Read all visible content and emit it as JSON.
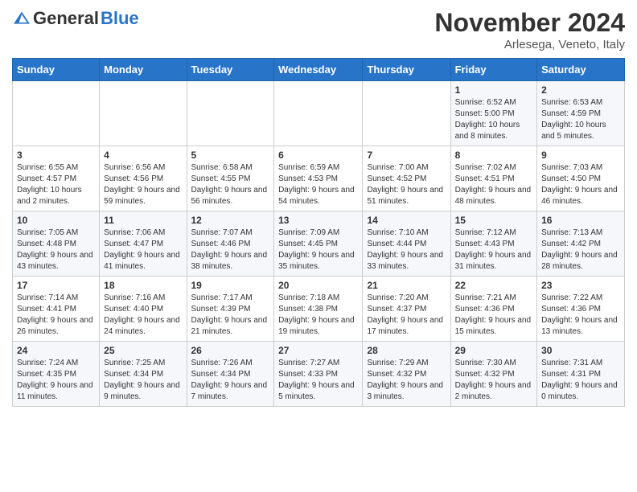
{
  "logo": {
    "general": "General",
    "blue": "Blue"
  },
  "title": "November 2024",
  "location": "Arlesega, Veneto, Italy",
  "days_of_week": [
    "Sunday",
    "Monday",
    "Tuesday",
    "Wednesday",
    "Thursday",
    "Friday",
    "Saturday"
  ],
  "weeks": [
    [
      {
        "day": "",
        "info": ""
      },
      {
        "day": "",
        "info": ""
      },
      {
        "day": "",
        "info": ""
      },
      {
        "day": "",
        "info": ""
      },
      {
        "day": "",
        "info": ""
      },
      {
        "day": "1",
        "info": "Sunrise: 6:52 AM\nSunset: 5:00 PM\nDaylight: 10 hours and 8 minutes."
      },
      {
        "day": "2",
        "info": "Sunrise: 6:53 AM\nSunset: 4:59 PM\nDaylight: 10 hours and 5 minutes."
      }
    ],
    [
      {
        "day": "3",
        "info": "Sunrise: 6:55 AM\nSunset: 4:57 PM\nDaylight: 10 hours and 2 minutes."
      },
      {
        "day": "4",
        "info": "Sunrise: 6:56 AM\nSunset: 4:56 PM\nDaylight: 9 hours and 59 minutes."
      },
      {
        "day": "5",
        "info": "Sunrise: 6:58 AM\nSunset: 4:55 PM\nDaylight: 9 hours and 56 minutes."
      },
      {
        "day": "6",
        "info": "Sunrise: 6:59 AM\nSunset: 4:53 PM\nDaylight: 9 hours and 54 minutes."
      },
      {
        "day": "7",
        "info": "Sunrise: 7:00 AM\nSunset: 4:52 PM\nDaylight: 9 hours and 51 minutes."
      },
      {
        "day": "8",
        "info": "Sunrise: 7:02 AM\nSunset: 4:51 PM\nDaylight: 9 hours and 48 minutes."
      },
      {
        "day": "9",
        "info": "Sunrise: 7:03 AM\nSunset: 4:50 PM\nDaylight: 9 hours and 46 minutes."
      }
    ],
    [
      {
        "day": "10",
        "info": "Sunrise: 7:05 AM\nSunset: 4:48 PM\nDaylight: 9 hours and 43 minutes."
      },
      {
        "day": "11",
        "info": "Sunrise: 7:06 AM\nSunset: 4:47 PM\nDaylight: 9 hours and 41 minutes."
      },
      {
        "day": "12",
        "info": "Sunrise: 7:07 AM\nSunset: 4:46 PM\nDaylight: 9 hours and 38 minutes."
      },
      {
        "day": "13",
        "info": "Sunrise: 7:09 AM\nSunset: 4:45 PM\nDaylight: 9 hours and 35 minutes."
      },
      {
        "day": "14",
        "info": "Sunrise: 7:10 AM\nSunset: 4:44 PM\nDaylight: 9 hours and 33 minutes."
      },
      {
        "day": "15",
        "info": "Sunrise: 7:12 AM\nSunset: 4:43 PM\nDaylight: 9 hours and 31 minutes."
      },
      {
        "day": "16",
        "info": "Sunrise: 7:13 AM\nSunset: 4:42 PM\nDaylight: 9 hours and 28 minutes."
      }
    ],
    [
      {
        "day": "17",
        "info": "Sunrise: 7:14 AM\nSunset: 4:41 PM\nDaylight: 9 hours and 26 minutes."
      },
      {
        "day": "18",
        "info": "Sunrise: 7:16 AM\nSunset: 4:40 PM\nDaylight: 9 hours and 24 minutes."
      },
      {
        "day": "19",
        "info": "Sunrise: 7:17 AM\nSunset: 4:39 PM\nDaylight: 9 hours and 21 minutes."
      },
      {
        "day": "20",
        "info": "Sunrise: 7:18 AM\nSunset: 4:38 PM\nDaylight: 9 hours and 19 minutes."
      },
      {
        "day": "21",
        "info": "Sunrise: 7:20 AM\nSunset: 4:37 PM\nDaylight: 9 hours and 17 minutes."
      },
      {
        "day": "22",
        "info": "Sunrise: 7:21 AM\nSunset: 4:36 PM\nDaylight: 9 hours and 15 minutes."
      },
      {
        "day": "23",
        "info": "Sunrise: 7:22 AM\nSunset: 4:36 PM\nDaylight: 9 hours and 13 minutes."
      }
    ],
    [
      {
        "day": "24",
        "info": "Sunrise: 7:24 AM\nSunset: 4:35 PM\nDaylight: 9 hours and 11 minutes."
      },
      {
        "day": "25",
        "info": "Sunrise: 7:25 AM\nSunset: 4:34 PM\nDaylight: 9 hours and 9 minutes."
      },
      {
        "day": "26",
        "info": "Sunrise: 7:26 AM\nSunset: 4:34 PM\nDaylight: 9 hours and 7 minutes."
      },
      {
        "day": "27",
        "info": "Sunrise: 7:27 AM\nSunset: 4:33 PM\nDaylight: 9 hours and 5 minutes."
      },
      {
        "day": "28",
        "info": "Sunrise: 7:29 AM\nSunset: 4:32 PM\nDaylight: 9 hours and 3 minutes."
      },
      {
        "day": "29",
        "info": "Sunrise: 7:30 AM\nSunset: 4:32 PM\nDaylight: 9 hours and 2 minutes."
      },
      {
        "day": "30",
        "info": "Sunrise: 7:31 AM\nSunset: 4:31 PM\nDaylight: 9 hours and 0 minutes."
      }
    ]
  ]
}
